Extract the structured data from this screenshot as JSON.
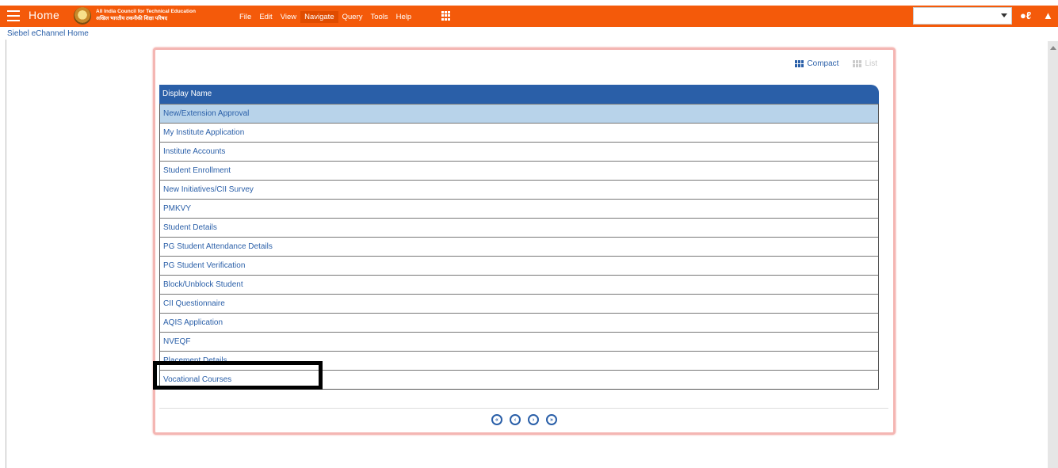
{
  "header": {
    "home_label": "Home",
    "org_name_en": "All India Council for Technical Education",
    "org_name_hi": "अखिल भारतीय तकनीकी शिक्षा परिषद",
    "menu": [
      "File",
      "Edit",
      "View",
      "Navigate",
      "Query",
      "Tools",
      "Help"
    ],
    "active_menu": "Navigate",
    "user_icon_glyph": "❤",
    "person_glyph": "♟"
  },
  "breadcrumb": "Siebel eChannel Home",
  "panel": {
    "compact_label": "Compact",
    "list_label": "List",
    "column_header": "Display Name",
    "rows": [
      "New/Extension Approval",
      "My Institute Application",
      "Institute Accounts",
      "Student Enrollment",
      "New Initiatives/CII Survey",
      "PMKVY",
      "Student Details",
      "PG Student Attendance Details",
      "PG Student Verification",
      "Block/Unblock Student",
      "CII Questionnaire",
      "AQIS Application",
      "NVEQF",
      "Placement Details",
      "Vocational Courses"
    ],
    "selected_row": "New/Extension Approval",
    "highlighted_row": "Placement Details"
  },
  "pager": {
    "first_glyph": "«",
    "prev_glyph": "‹",
    "next_glyph": "›",
    "last_glyph": "»"
  },
  "colors": {
    "topbar": "#f45a0a",
    "accent": "#2a5fa8",
    "selected_row": "#b8d3ea",
    "panel_border": "#f4b6b3"
  }
}
